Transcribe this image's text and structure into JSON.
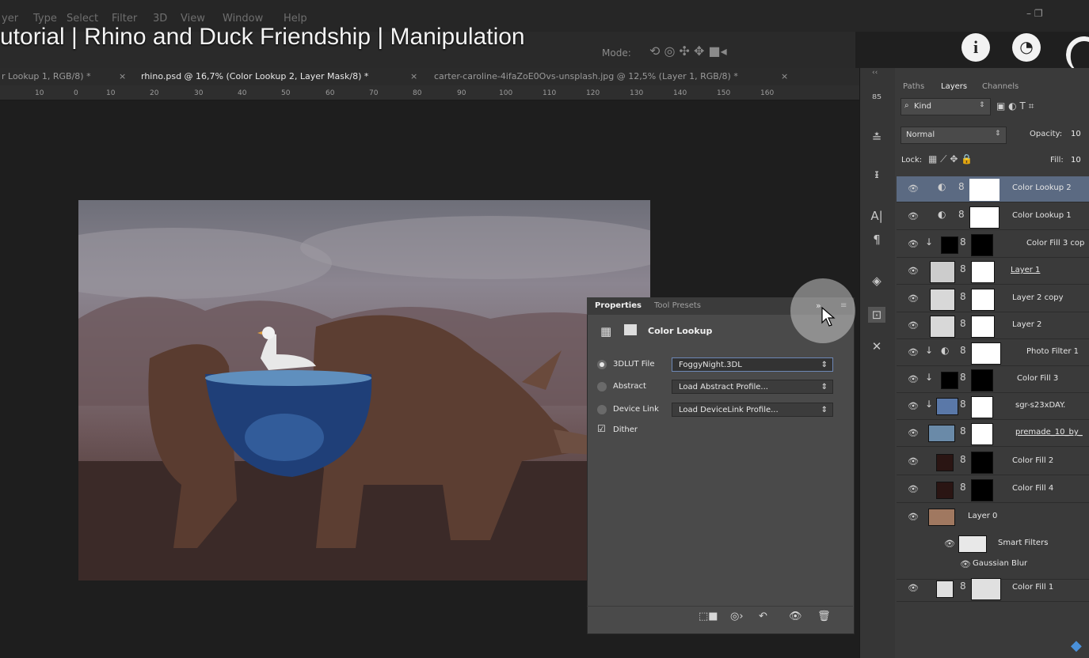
{
  "video_title": "utorial | Rhino and Duck Friendship | Manipulation",
  "menu": [
    "yer",
    "Type",
    "Select",
    "Filter",
    "3D",
    "View",
    "Window",
    "Help"
  ],
  "options_bar": {
    "mode_label": "Mode:"
  },
  "tabs": [
    {
      "label": "r Lookup 1, RGB/8) *",
      "close": "×"
    },
    {
      "label": "rhino.psd @ 16,7% (Color Lookup 2, Layer Mask/8) *",
      "close": "×"
    },
    {
      "label": "carter-caroline-4ifaZoE0Ovs-unsplash.jpg @ 12,5% (Layer 1, RGB/8) *",
      "close": "×"
    }
  ],
  "ruler_ticks": [
    "10",
    "0",
    "10",
    "20",
    "30",
    "40",
    "50",
    "60",
    "70",
    "80",
    "90",
    "100",
    "110",
    "120",
    "130",
    "140",
    "150",
    "160"
  ],
  "properties": {
    "tabs": [
      "Properties",
      "Tool Presets"
    ],
    "header": "Color Lookup",
    "rows": [
      {
        "label": "3DLUT File",
        "value": "FoggyNight.3DL",
        "selected": true
      },
      {
        "label": "Abstract",
        "value": "Load Abstract Profile...",
        "selected": false
      },
      {
        "label": "Device Link",
        "value": "Load DeviceLink Profile...",
        "selected": false
      }
    ],
    "dither_label": "Dither",
    "dither_checked": true
  },
  "layers_panel": {
    "tabs": [
      "Paths",
      "Layers",
      "Channels"
    ],
    "kind_label": "Kind",
    "blend_mode": "Normal",
    "opacity_label": "Opacity:",
    "opacity_value": "10",
    "lock_label": "Lock:",
    "fill_label": "Fill:",
    "fill_value": "10",
    "layers": [
      {
        "name": "Color Lookup 2",
        "selected": true
      },
      {
        "name": "Color Lookup 1",
        "selected": false
      },
      {
        "name": "Color Fill 3 cop",
        "selected": false
      },
      {
        "name": "Layer 1",
        "selected": false
      },
      {
        "name": "Layer 2 copy",
        "selected": false
      },
      {
        "name": "Layer 2",
        "selected": false
      },
      {
        "name": "Photo Filter 1",
        "selected": false
      },
      {
        "name": "Color Fill 3",
        "selected": false
      },
      {
        "name": "sgr-s23xDAY.",
        "selected": false
      },
      {
        "name": "premade_10_by_",
        "selected": false
      },
      {
        "name": "Color Fill 2",
        "selected": false
      },
      {
        "name": "Color Fill 4",
        "selected": false
      },
      {
        "name": "Layer 0",
        "selected": false
      },
      {
        "name": "Smart Filters",
        "selected": false
      },
      {
        "name": "Gaussian Blur",
        "selected": false
      },
      {
        "name": "Color Fill 1",
        "selected": false
      }
    ]
  },
  "colors": {
    "selected_layer": "#5b6a82",
    "panel_bg": "#3a3a3a",
    "canvas_bg": "#1e1e1e"
  }
}
